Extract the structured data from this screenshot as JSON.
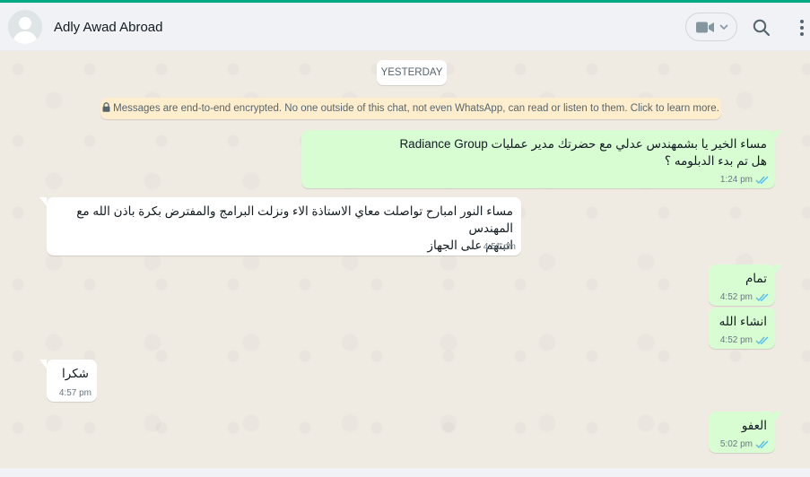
{
  "header": {
    "contact_name": "Adly Awad Abroad",
    "icons": [
      "avatar-placeholder-icon",
      "video-camera-icon",
      "chevron-down-icon",
      "search-icon",
      "more-vertical-icon"
    ]
  },
  "chat": {
    "date_separator": "YESTERDAY",
    "encryption_notice": "Messages are end-to-end encrypted. No one outside of this chat, not even WhatsApp, can read or listen to them. Click to learn more.",
    "messages": [
      {
        "direction": "outgoing",
        "lines": [
          "مساء الخير يا بشمهندس عدلي مع حضرتك  مدير عمليات Radiance Group",
          "هل تم بدء الدبلومه ؟"
        ],
        "time": "1:24 pm",
        "status": "read"
      },
      {
        "direction": "incoming",
        "lines": [
          "مساء النور امبارح تواصلت معاي الاستاذة الاء ونزلت البرامج والمفترض بكرة باذن الله مع المهندس",
          "اثبتهم على الجهاز"
        ],
        "time": "4:51 pm"
      },
      {
        "direction": "outgoing",
        "lines": [
          "تمام"
        ],
        "time": "4:52 pm",
        "status": "read"
      },
      {
        "direction": "outgoing",
        "lines": [
          "انشاء الله"
        ],
        "time": "4:52 pm",
        "status": "read"
      },
      {
        "direction": "incoming",
        "lines": [
          "شكرا"
        ],
        "time": "4:57 pm"
      },
      {
        "direction": "outgoing",
        "lines": [
          "العفو"
        ],
        "time": "5:02 pm",
        "status": "read"
      }
    ]
  },
  "colors": {
    "accent": "#00a884",
    "outgoing_bubble": "#d9fdd3",
    "incoming_bubble": "#ffffff",
    "read_ticks": "#53bdeb",
    "encryption_banner": "#ffeecd"
  }
}
